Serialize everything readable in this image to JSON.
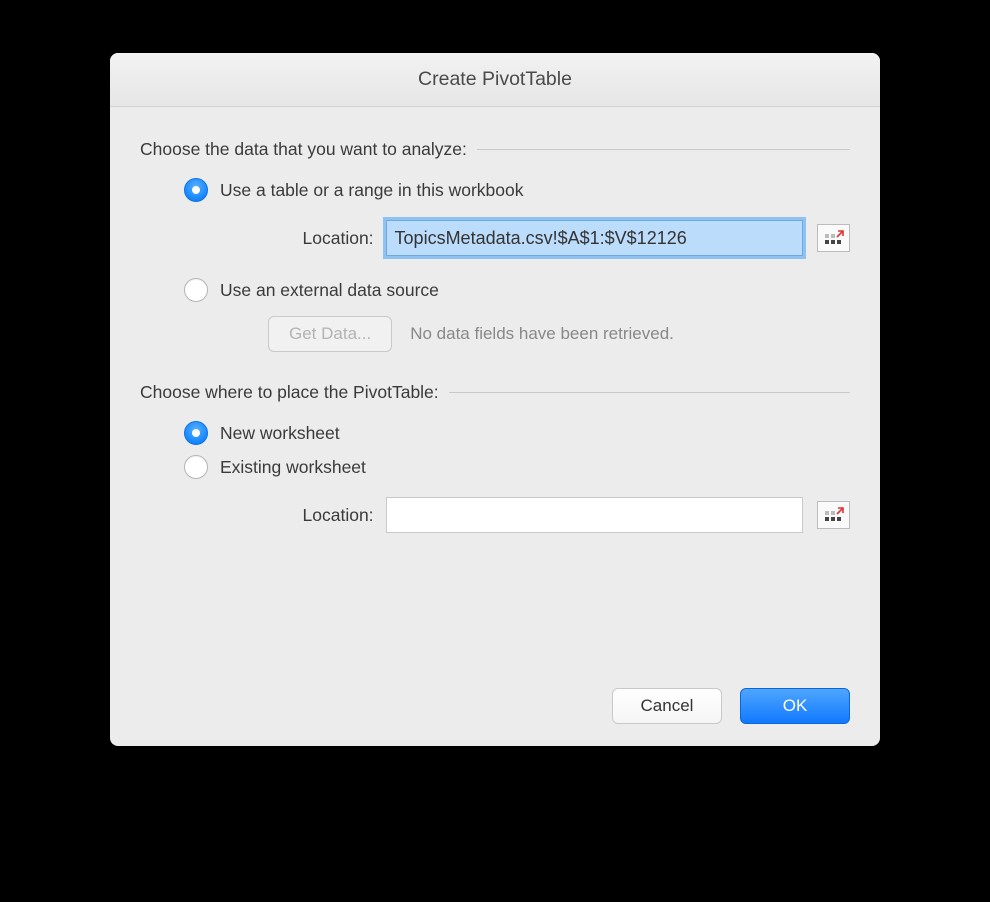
{
  "dialog": {
    "title": "Create PivotTable"
  },
  "section1": {
    "heading": "Choose the data that you want to analyze:",
    "opt_table_range": "Use a table or a range in this workbook",
    "location_label": "Location:",
    "location_value": "TopicsMetadata.csv!$A$1:$V$12126",
    "opt_external": "Use an external data source",
    "get_data_btn": "Get Data...",
    "get_data_hint": "No data fields have been retrieved."
  },
  "section2": {
    "heading": "Choose where to place the PivotTable:",
    "opt_new_ws": "New worksheet",
    "opt_existing_ws": "Existing worksheet",
    "location_label": "Location:",
    "location_value": ""
  },
  "footer": {
    "cancel": "Cancel",
    "ok": "OK"
  }
}
